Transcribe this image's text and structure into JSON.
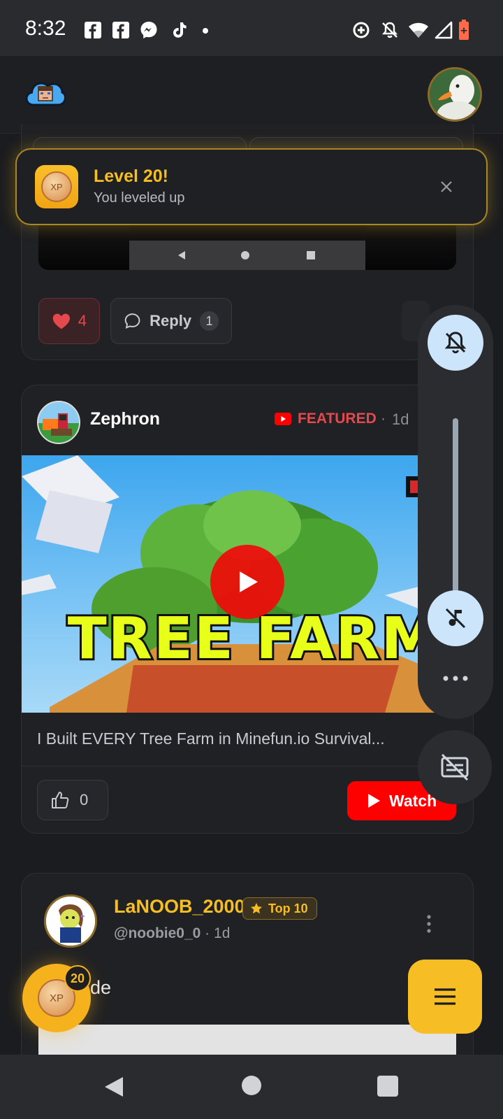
{
  "status_bar": {
    "time": "8:32",
    "left_icons": [
      "facebook-icon",
      "facebook-icon",
      "messenger-icon",
      "tiktok-icon",
      "dot-icon"
    ],
    "right_icons": [
      "data-saver-icon",
      "bell-off-icon",
      "wifi-icon",
      "signal-icon",
      "battery-icon"
    ]
  },
  "toast": {
    "title": "Level 20!",
    "subtitle": "You leveled up",
    "badge": "XP"
  },
  "post1": {
    "like_count": "4",
    "reply_label": "Reply",
    "reply_count": "1"
  },
  "post2": {
    "author": "Zephron",
    "featured_label": "FEATURED",
    "time": "1d",
    "thumbnail_text": "TREE FARM",
    "video_title": "I Built EVERY Tree Farm in Minefun.io Survival...",
    "like_count": "0",
    "watch_label": "Watch"
  },
  "post3": {
    "author": "LaNOOB_2000",
    "rank_badge": "Top 10",
    "handle": "@noobie0_0",
    "time": "1d",
    "body_text": "de"
  },
  "xp_fab": {
    "level": "20",
    "label": "XP"
  },
  "colors": {
    "accent_gold": "#f6be24",
    "like_red": "#e5484d",
    "youtube_red": "#ff0000",
    "volume_blue": "#cde5fb"
  }
}
